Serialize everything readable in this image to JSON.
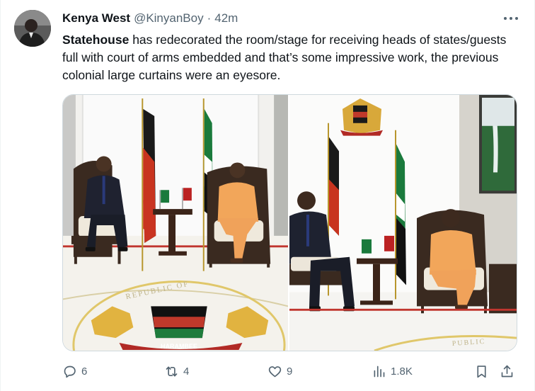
{
  "author": {
    "name": "Kenya West",
    "handle": "@KinyanBoy",
    "separator": "·",
    "time": "42m"
  },
  "tweet": {
    "lead": "Statehouse",
    "body": " has redecorated the room/stage for receiving heads of states/guests full with court of arms embedded and that’s some impressive work, the previous colonial large curtains were an eyesore."
  },
  "media": {
    "floor_seal_text": "REPUBLIC OF",
    "motto": "HARAMBEE",
    "floor_seal_text_right": "PUBLIC"
  },
  "actions": {
    "replies": "6",
    "reposts": "4",
    "likes": "9",
    "views": "1.8K"
  },
  "icons": {
    "reply": "speech-bubble-icon",
    "repost": "repost-arrows-icon",
    "like": "heart-icon",
    "views": "bar-chart-icon",
    "bookmark": "bookmark-icon",
    "share": "share-icon",
    "more": "more-dots-icon"
  },
  "colors": {
    "text": "#0f1419",
    "muted": "#536471",
    "border": "#cfd9de"
  }
}
